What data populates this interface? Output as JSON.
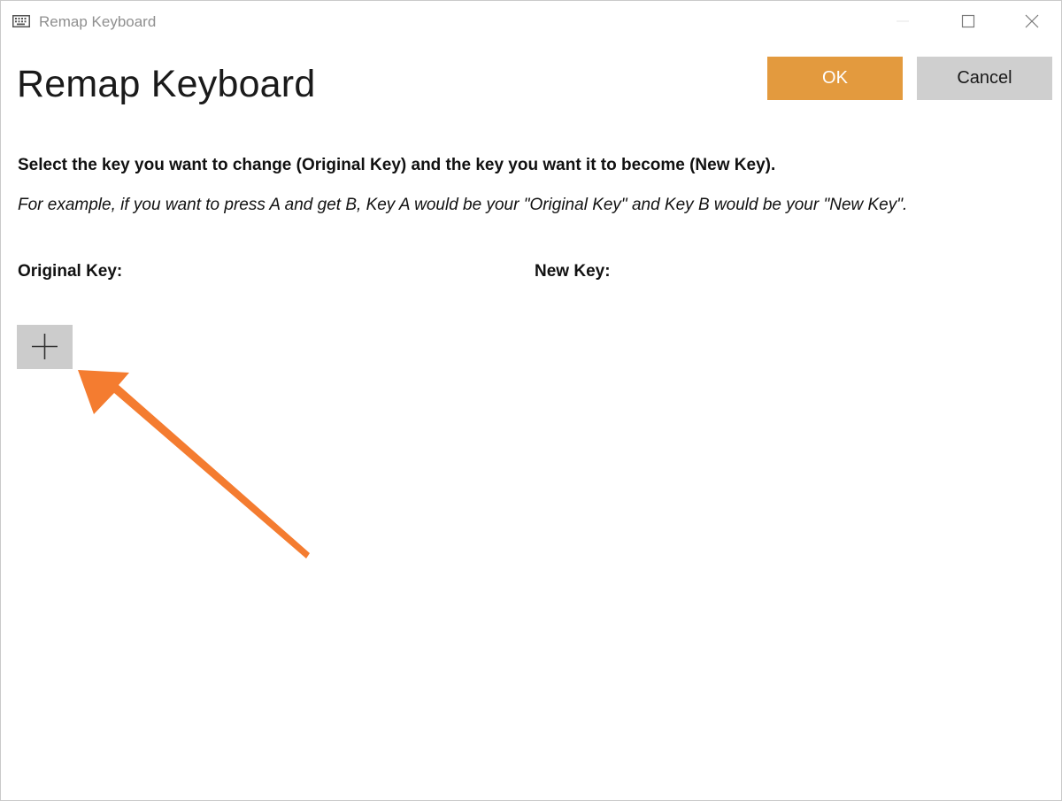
{
  "window": {
    "title": "Remap Keyboard",
    "icon": "keyboard-icon",
    "controls": [
      "minimize-icon",
      "maximize-icon",
      "close-icon"
    ]
  },
  "header": {
    "page_title": "Remap Keyboard",
    "ok_label": "OK",
    "cancel_label": "Cancel"
  },
  "body": {
    "instruction": "Select the key you want to change (Original Key) and the key you want it to become (New Key).",
    "example": "For example, if you want to press A and get B, Key A would be your \"Original Key\" and Key B would be your \"New Key\".",
    "original_key_label": "Original Key:",
    "new_key_label": "New Key:",
    "add_button_icon": "plus-icon"
  },
  "colors": {
    "ok_button": "#e39a3e",
    "cancel_button": "#cfcfcf",
    "add_button": "#cccccc",
    "callout_arrow": "#f47c30"
  }
}
